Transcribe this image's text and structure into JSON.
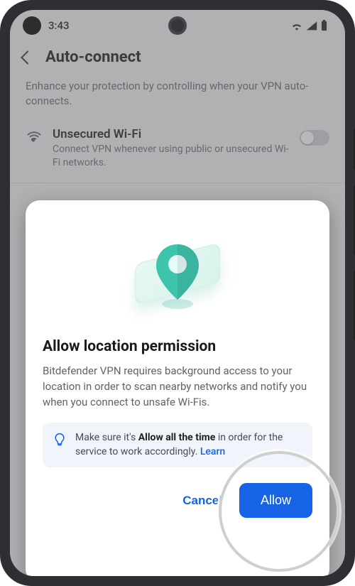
{
  "status": {
    "time": "3:43"
  },
  "header": {
    "title": "Auto-connect",
    "subtitle": "Enhance your protection by controlling when your VPN auto-connects."
  },
  "setting": {
    "title": "Unsecured Wi-Fi",
    "desc": "Connect VPN whenever using public or unsecured Wi-Fi networks."
  },
  "modal": {
    "title": "Allow location permission",
    "body": "Bitdefender VPN requires background access to your location in order to scan nearby networks and notify you when you connect to unsafe Wi-Fis.",
    "tip_prefix": "Make sure it's ",
    "tip_bold": "Allow all the time",
    "tip_suffix": " in order for the service to work accordingly. ",
    "tip_link": "Learn",
    "cancel": "Cancel",
    "allow": "Allow"
  }
}
